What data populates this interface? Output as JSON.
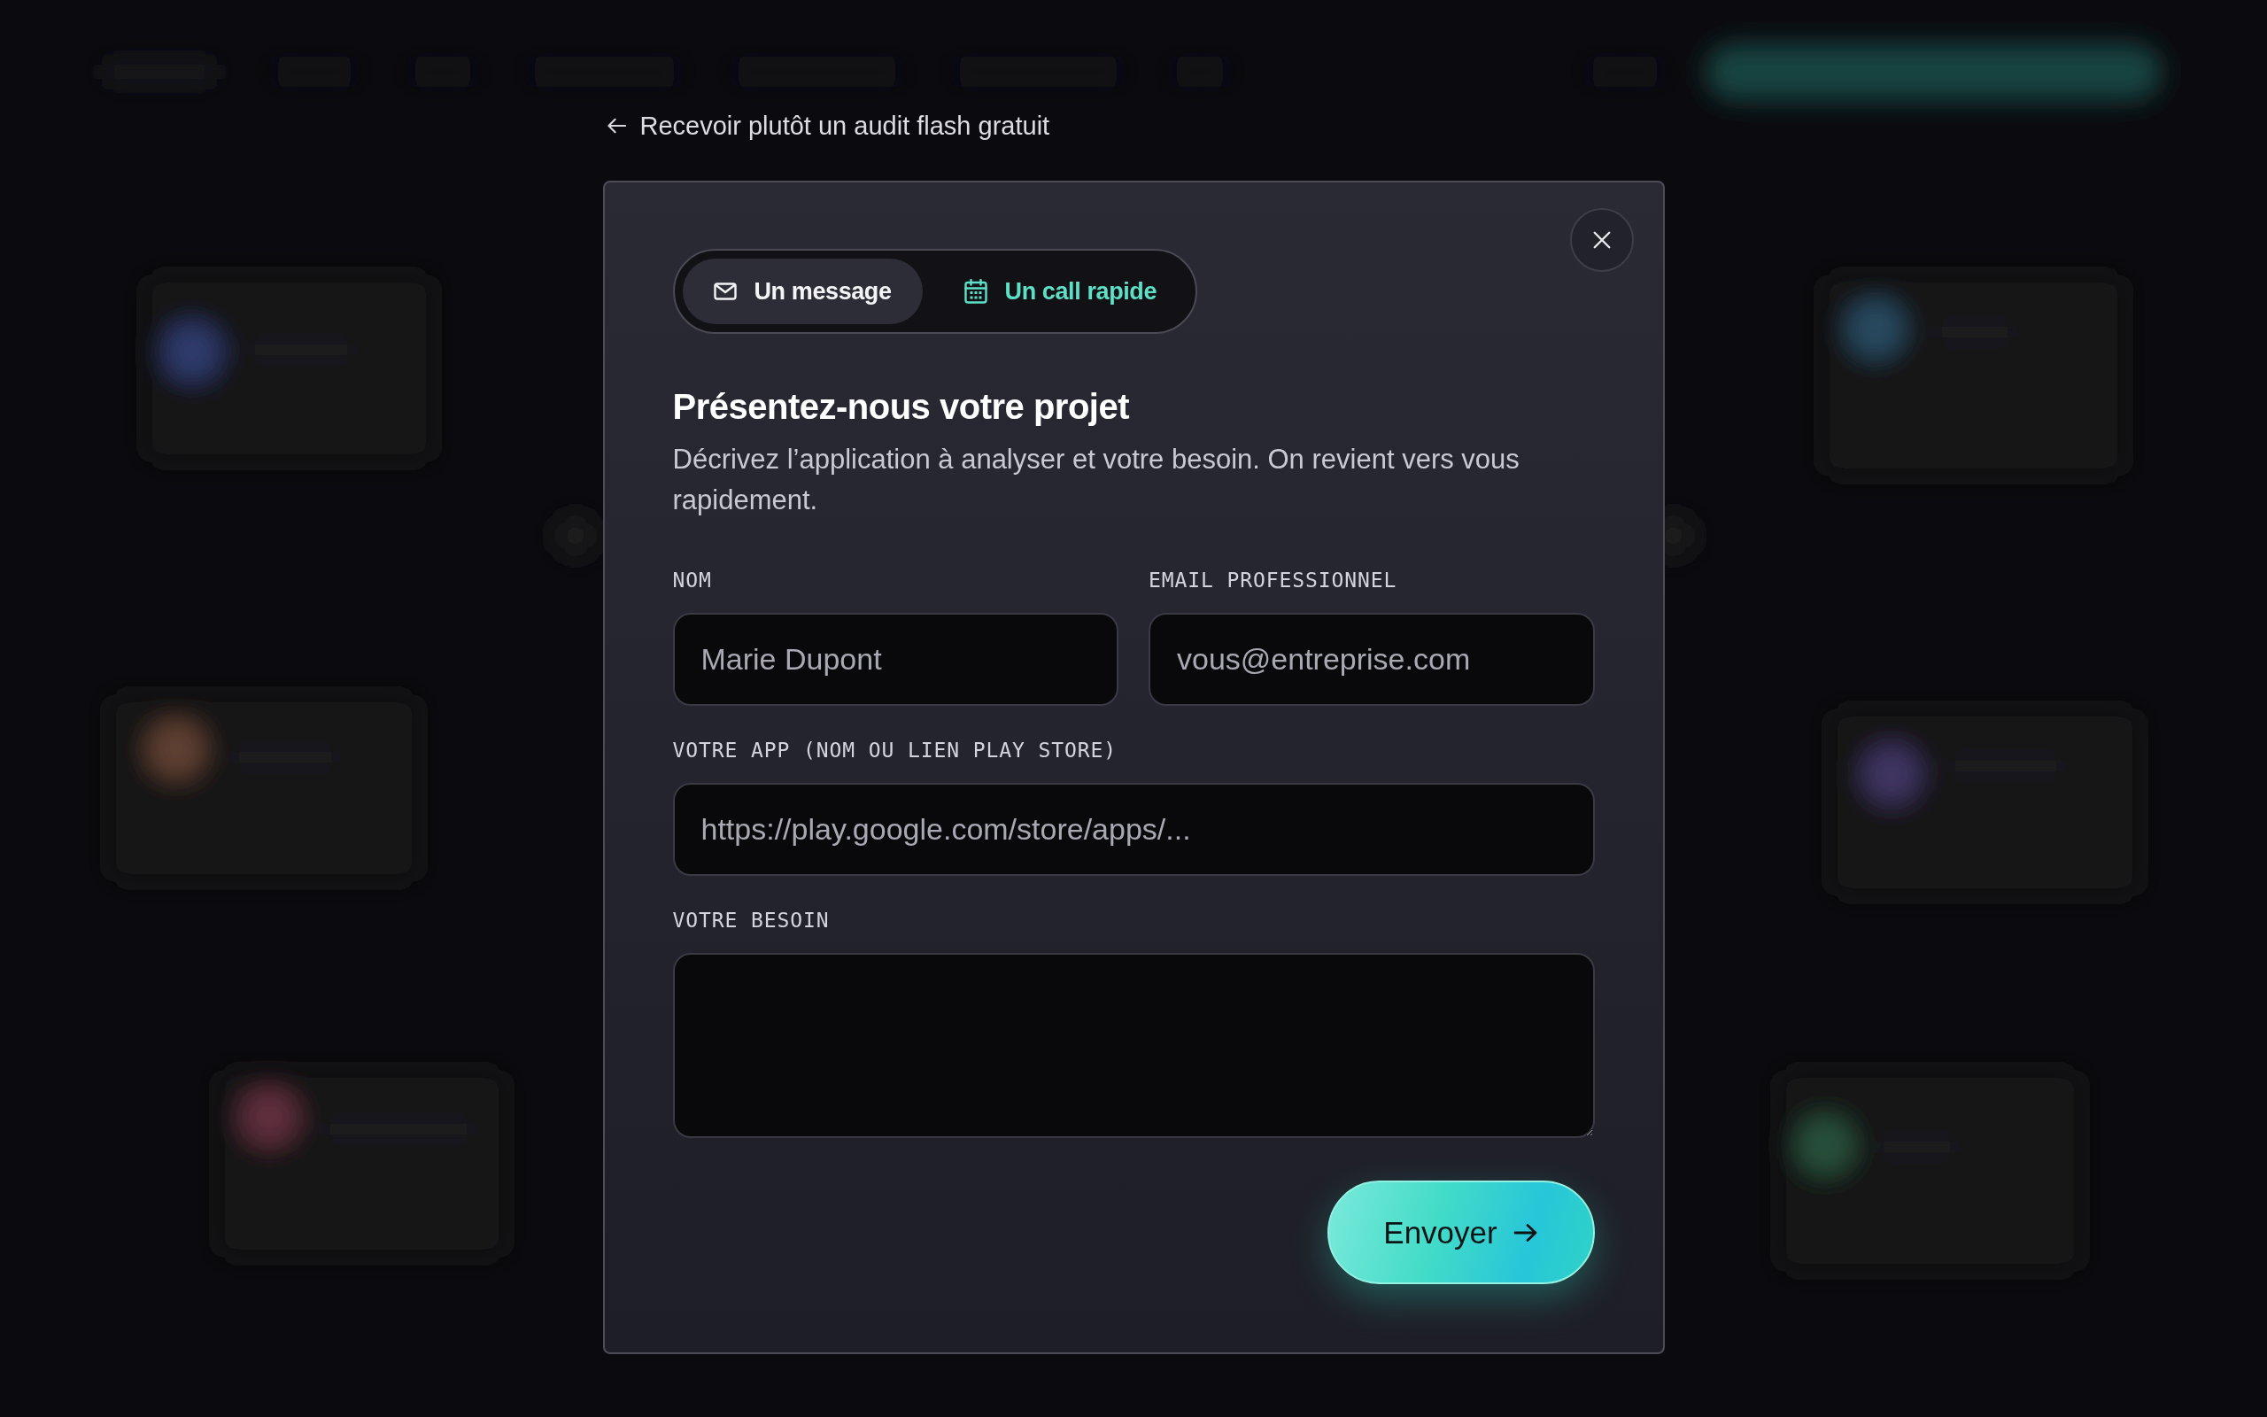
{
  "back_link": {
    "label": "Recevoir plutôt un audit flash gratuit"
  },
  "modal": {
    "tabs": [
      {
        "label": "Un message",
        "kind": "message",
        "selected": true
      },
      {
        "label": "Un call rapide",
        "kind": "call",
        "selected": false
      }
    ],
    "title": "Présentez-nous votre projet",
    "description": "Décrivez l’application à analyser et votre besoin. On revient vers vous rapidement.",
    "rows": [
      {
        "fields": [
          {
            "label": "NOM",
            "kind": "text",
            "placeholder": "Marie Dupont"
          },
          {
            "label": "EMAIL PROFESSIONNEL",
            "kind": "text",
            "placeholder": "vous@entreprise.com"
          }
        ]
      },
      {
        "fields": [
          {
            "label": "VOTRE APP (NOM OU LIEN PLAY STORE)",
            "kind": "text",
            "placeholder": "https://play.google.com/store/apps/..."
          }
        ]
      },
      {
        "fields": [
          {
            "label": "VOTRE BESOIN",
            "kind": "textarea"
          }
        ]
      }
    ],
    "submit_button": {
      "label": "Envoyer"
    }
  }
}
